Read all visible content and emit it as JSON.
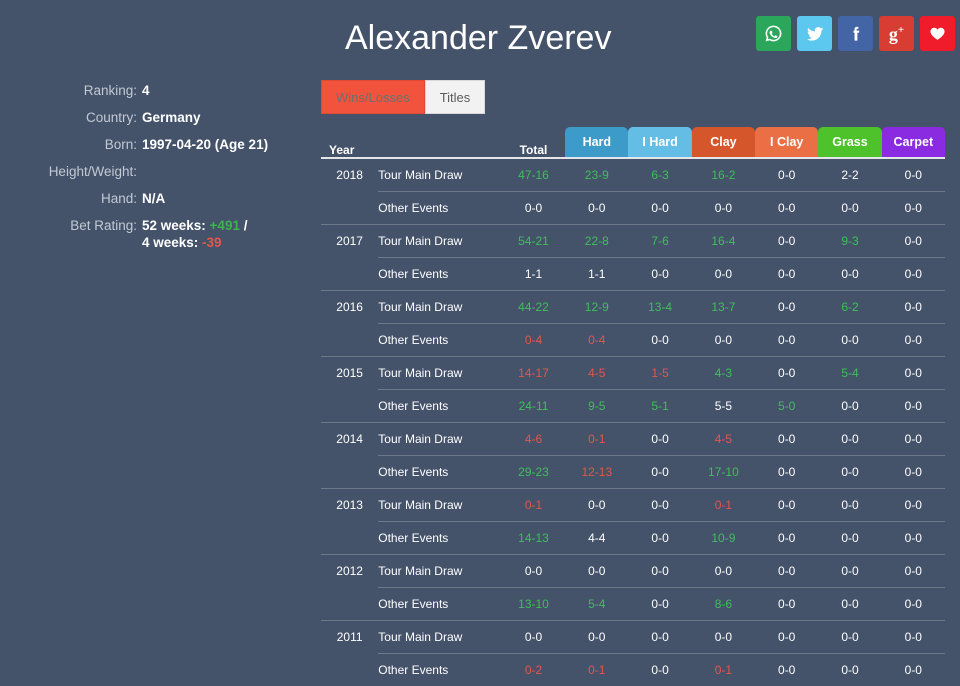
{
  "header": {
    "player_name": "Alexander Zverev",
    "social": [
      {
        "name": "whatsapp-icon",
        "label": "WhatsApp",
        "color": "#2aa75a"
      },
      {
        "name": "twitter-icon",
        "label": "Twitter",
        "color": "#5cc8f0"
      },
      {
        "name": "facebook-icon",
        "label": "Facebook",
        "color": "#4465a5"
      },
      {
        "name": "google-plus-icon",
        "label": "Google+",
        "color": "#d73d32"
      },
      {
        "name": "favorite-icon",
        "label": "Favorite",
        "color": "#f01c2c"
      }
    ]
  },
  "info": {
    "rows": [
      {
        "label": "Ranking:",
        "value": "4"
      },
      {
        "label": "Country:",
        "value": "Germany"
      },
      {
        "label": "Born:",
        "value": "1997-04-20 (Age 21)"
      },
      {
        "label": "Height/Weight:",
        "value": ""
      },
      {
        "label": "Hand:",
        "value": "N/A"
      }
    ],
    "bet_rating": {
      "label": "Bet Rating:",
      "line1_prefix": "52 weeks: ",
      "line1_value": "+491",
      "line1_suffix": " /",
      "line2_prefix": "4 weeks: ",
      "line2_value": "-39"
    }
  },
  "tabs": [
    {
      "label": "Wins/Losses",
      "active": true
    },
    {
      "label": "Titles",
      "active": false
    }
  ],
  "table": {
    "headers": [
      {
        "label": "Year",
        "color": null
      },
      {
        "label": "",
        "color": null
      },
      {
        "label": "Total",
        "color": null
      },
      {
        "label": "Hard",
        "color": "#3d9bc9"
      },
      {
        "label": "I Hard",
        "color": "#63bde4"
      },
      {
        "label": "Clay",
        "color": "#d4562a"
      },
      {
        "label": "I Clay",
        "color": "#ea6f45"
      },
      {
        "label": "Grass",
        "color": "#4ec22b"
      },
      {
        "label": "Carpet",
        "color": "#8a2be2"
      }
    ],
    "row_types": {
      "main": "Tour Main Draw",
      "sub": "Other Events"
    },
    "rows": [
      {
        "year": "2018",
        "type": "main",
        "values": [
          "47-16",
          "23-9",
          "6-3",
          "16-2",
          "0-0",
          "2-2",
          "0-0"
        ]
      },
      {
        "year": "",
        "type": "sub",
        "values": [
          "0-0",
          "0-0",
          "0-0",
          "0-0",
          "0-0",
          "0-0",
          "0-0"
        ]
      },
      {
        "year": "2017",
        "type": "main",
        "values": [
          "54-21",
          "22-8",
          "7-6",
          "16-4",
          "0-0",
          "9-3",
          "0-0"
        ]
      },
      {
        "year": "",
        "type": "sub",
        "values": [
          "1-1",
          "1-1",
          "0-0",
          "0-0",
          "0-0",
          "0-0",
          "0-0"
        ]
      },
      {
        "year": "2016",
        "type": "main",
        "values": [
          "44-22",
          "12-9",
          "13-4",
          "13-7",
          "0-0",
          "6-2",
          "0-0"
        ]
      },
      {
        "year": "",
        "type": "sub",
        "values": [
          "0-4",
          "0-4",
          "0-0",
          "0-0",
          "0-0",
          "0-0",
          "0-0"
        ]
      },
      {
        "year": "2015",
        "type": "main",
        "values": [
          "14-17",
          "4-5",
          "1-5",
          "4-3",
          "0-0",
          "5-4",
          "0-0"
        ]
      },
      {
        "year": "",
        "type": "sub",
        "values": [
          "24-11",
          "9-5",
          "5-1",
          "5-5",
          "5-0",
          "0-0",
          "0-0"
        ]
      },
      {
        "year": "2014",
        "type": "main",
        "values": [
          "4-6",
          "0-1",
          "0-0",
          "4-5",
          "0-0",
          "0-0",
          "0-0"
        ]
      },
      {
        "year": "",
        "type": "sub",
        "values": [
          "29-23",
          "12-13",
          "0-0",
          "17-10",
          "0-0",
          "0-0",
          "0-0"
        ]
      },
      {
        "year": "2013",
        "type": "main",
        "values": [
          "0-1",
          "0-0",
          "0-0",
          "0-1",
          "0-0",
          "0-0",
          "0-0"
        ]
      },
      {
        "year": "",
        "type": "sub",
        "values": [
          "14-13",
          "4-4",
          "0-0",
          "10-9",
          "0-0",
          "0-0",
          "0-0"
        ]
      },
      {
        "year": "2012",
        "type": "main",
        "values": [
          "0-0",
          "0-0",
          "0-0",
          "0-0",
          "0-0",
          "0-0",
          "0-0"
        ]
      },
      {
        "year": "",
        "type": "sub",
        "values": [
          "13-10",
          "5-4",
          "0-0",
          "8-6",
          "0-0",
          "0-0",
          "0-0"
        ]
      },
      {
        "year": "2011",
        "type": "main",
        "values": [
          "0-0",
          "0-0",
          "0-0",
          "0-0",
          "0-0",
          "0-0",
          "0-0"
        ]
      },
      {
        "year": "",
        "type": "sub",
        "values": [
          "0-2",
          "0-1",
          "0-0",
          "0-1",
          "0-0",
          "0-0",
          "0-0"
        ]
      }
    ]
  },
  "colors": {
    "background": "#44526a",
    "win": "#3fbf5a",
    "loss": "#e2574c",
    "neutral": "#ffffff",
    "tab_active": "#f1533c"
  }
}
